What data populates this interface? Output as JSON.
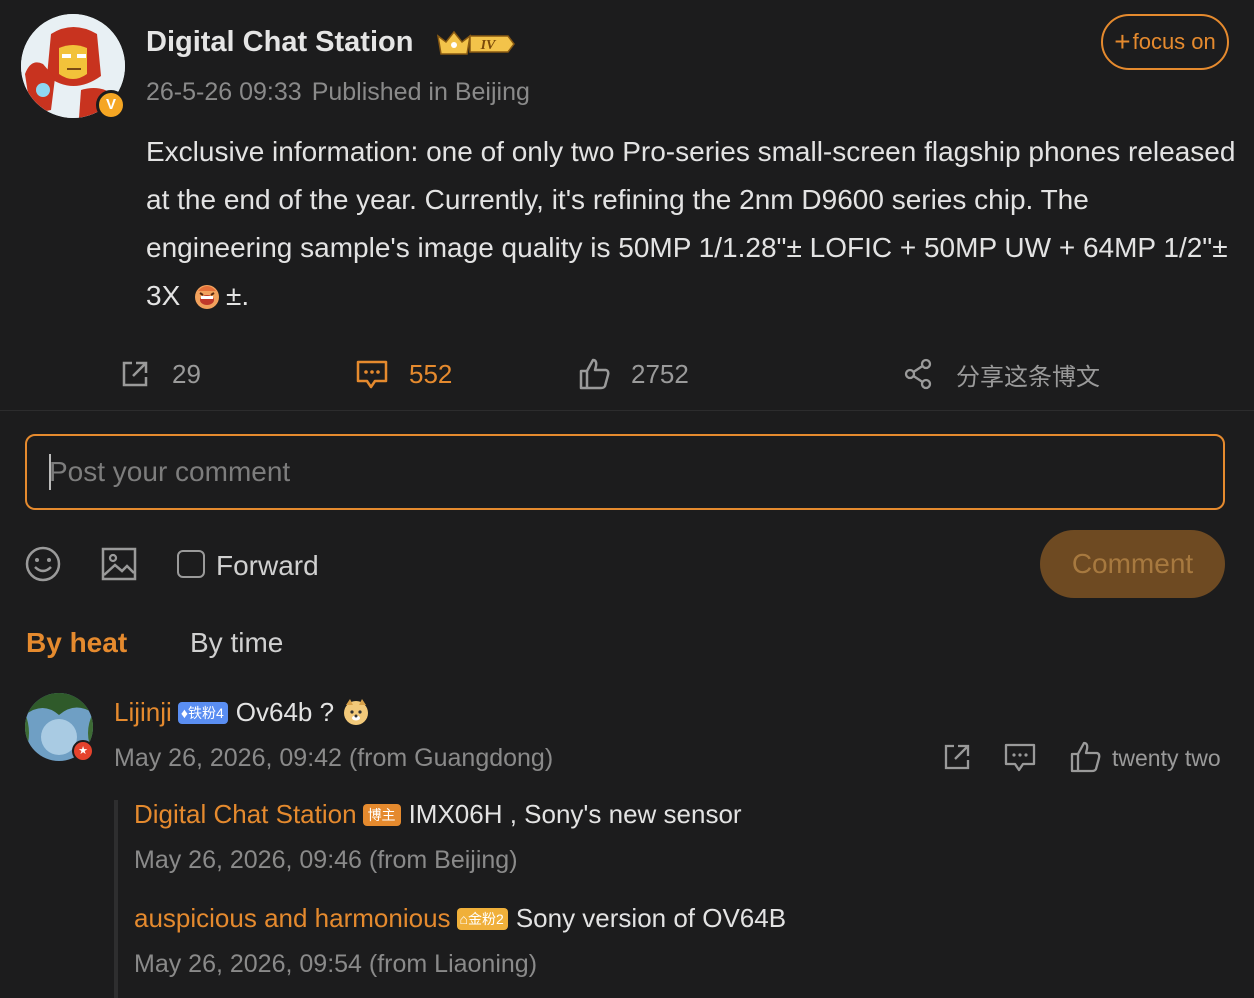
{
  "post": {
    "author": "Digital Chat Station",
    "verified_mark": "V",
    "level_badge": "IV",
    "date": "26-5-26 09:33",
    "location": "Published in Beijing",
    "follow_label": "focus on",
    "text_part1": "Exclusive information: one of only two Pro-series small-screen flagship phones released at the end of the year. Currently, it's refining the 2nm D9600 series chip. The engineering sample's image quality is 50MP 1/1.28\"± LOFIC + 50MP UW + 64MP 1/2\"± 3X",
    "text_part2": "±.",
    "stats": {
      "forwards": "29",
      "comments": "552",
      "likes": "2752",
      "share_label": "分享这条博文"
    }
  },
  "composer": {
    "placeholder": "Post your comment",
    "forward_label": "Forward",
    "submit_label": "Comment"
  },
  "sort_tabs": {
    "heat": "By heat",
    "time": "By time"
  },
  "comments": [
    {
      "user": "Lijinji",
      "badge": "铁粉4",
      "text": "Ov64b  ?",
      "time": "May 26, 2026, 09:42 (from Guangdong)",
      "like_label": "twenty two",
      "replies": [
        {
          "user": "Digital Chat Station",
          "badge": "博主",
          "text": "IMX06H  , Sony's new sensor",
          "time": "May 26, 2026, 09:46 (from Beijing)"
        },
        {
          "user": "auspicious and harmonious",
          "badge": "金粉2",
          "text": "Sony  version of OV64B",
          "time": "May 26, 2026, 09:54 (from Liaoning)"
        }
      ]
    }
  ],
  "colors": {
    "background": "#1c1c1d",
    "accent": "#e58a2e",
    "muted": "#8a8a8a"
  }
}
